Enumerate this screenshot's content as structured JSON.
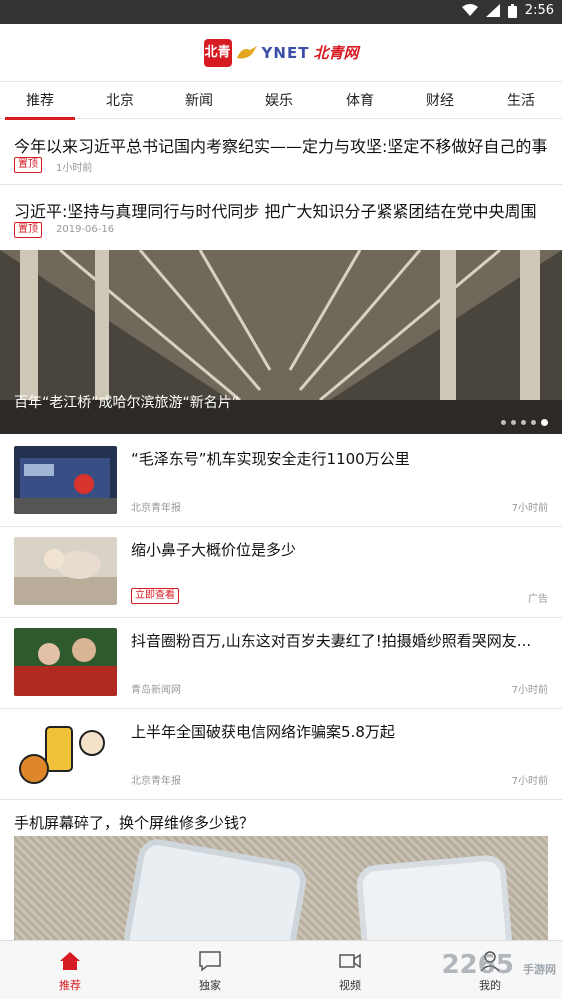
{
  "status": {
    "time": "2:56"
  },
  "header": {
    "logo_char": "北青",
    "logo_latin": "YNET",
    "logo_cn": "北青网"
  },
  "tabs": [
    "推荐",
    "北京",
    "新闻",
    "娱乐",
    "体育",
    "财经",
    "生活"
  ],
  "pinned": [
    {
      "title": "今年以来习近平总书记国内考察纪实——定力与攻坚:坚定不移做好自己的事",
      "badge": "置顶",
      "time": "1小时前"
    },
    {
      "title": "习近平:坚持与真理同行与时代同步 把广大知识分子紧紧团结在党中央周围",
      "badge": "置顶",
      "time": "2019-06-16"
    }
  ],
  "hero": {
    "caption": "百年“老江桥”成哈尔滨旅游“新名片”",
    "dots": 5,
    "active_dot": 4
  },
  "news": [
    {
      "title": "“毛泽东号”机车实现安全走行1100万公里",
      "source": "北京青年报",
      "time": "7小时前"
    },
    {
      "title": "缩小鼻子大概价位是多少",
      "ad_button": "立即查看",
      "time": "广告"
    },
    {
      "title": "抖音圈粉百万,山东这对百岁夫妻红了!拍摄婚纱照看哭网友...",
      "source": "青岛新闻网",
      "time": "7小时前"
    },
    {
      "title": "上半年全国破获电信网络诈骗案5.8万起",
      "source": "北京青年报",
      "time": "7小时前"
    }
  ],
  "big_item": {
    "title": "手机屏幕碎了，换个屏维修多少钱？"
  },
  "bottom_nav": [
    {
      "label": "推荐",
      "icon": "home-icon",
      "active": true
    },
    {
      "label": "独家",
      "icon": "chat-icon",
      "active": false
    },
    {
      "label": "视频",
      "icon": "video-icon",
      "active": false
    },
    {
      "label": "我的",
      "icon": "user-icon",
      "active": false
    }
  ],
  "watermark": {
    "main": "2265",
    "sub": "手游网"
  },
  "colors": {
    "accent": "#d61b22",
    "status_bar": "#333333"
  }
}
